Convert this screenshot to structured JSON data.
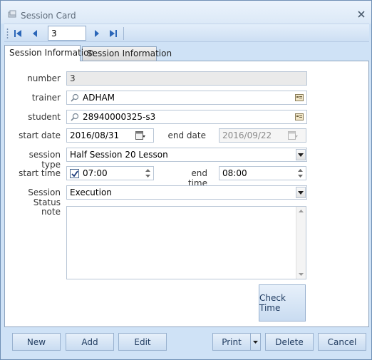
{
  "window": {
    "title": "Session Card"
  },
  "navigator": {
    "record_value": "3"
  },
  "tabs": [
    {
      "label": "Session Information"
    },
    {
      "label": "Session Information"
    }
  ],
  "form": {
    "number": {
      "label": "number",
      "value": "3"
    },
    "trainer": {
      "label": "trainer",
      "value": "ADHAM"
    },
    "student": {
      "label": "student",
      "value": "28940000325-s3"
    },
    "start_date": {
      "label": "start date",
      "value": "2016/08/31"
    },
    "end_date": {
      "label": "end date",
      "value": "2016/09/22"
    },
    "session_type": {
      "label": "session type",
      "value": "Half Session 20 Lesson"
    },
    "start_time": {
      "label": "start time",
      "value": "07:00",
      "checked": true
    },
    "end_time": {
      "label": "end time",
      "value": "08:00"
    },
    "session_status": {
      "label": "Session Status",
      "value": "Execution"
    },
    "note": {
      "label": "note",
      "value": ""
    },
    "check_time_label": "Check Time"
  },
  "footer": {
    "new_label": "New",
    "add_label": "Add",
    "edit_label": "Edit",
    "print_label": "Print",
    "delete_label": "Delete",
    "cancel_label": "Cancel"
  }
}
